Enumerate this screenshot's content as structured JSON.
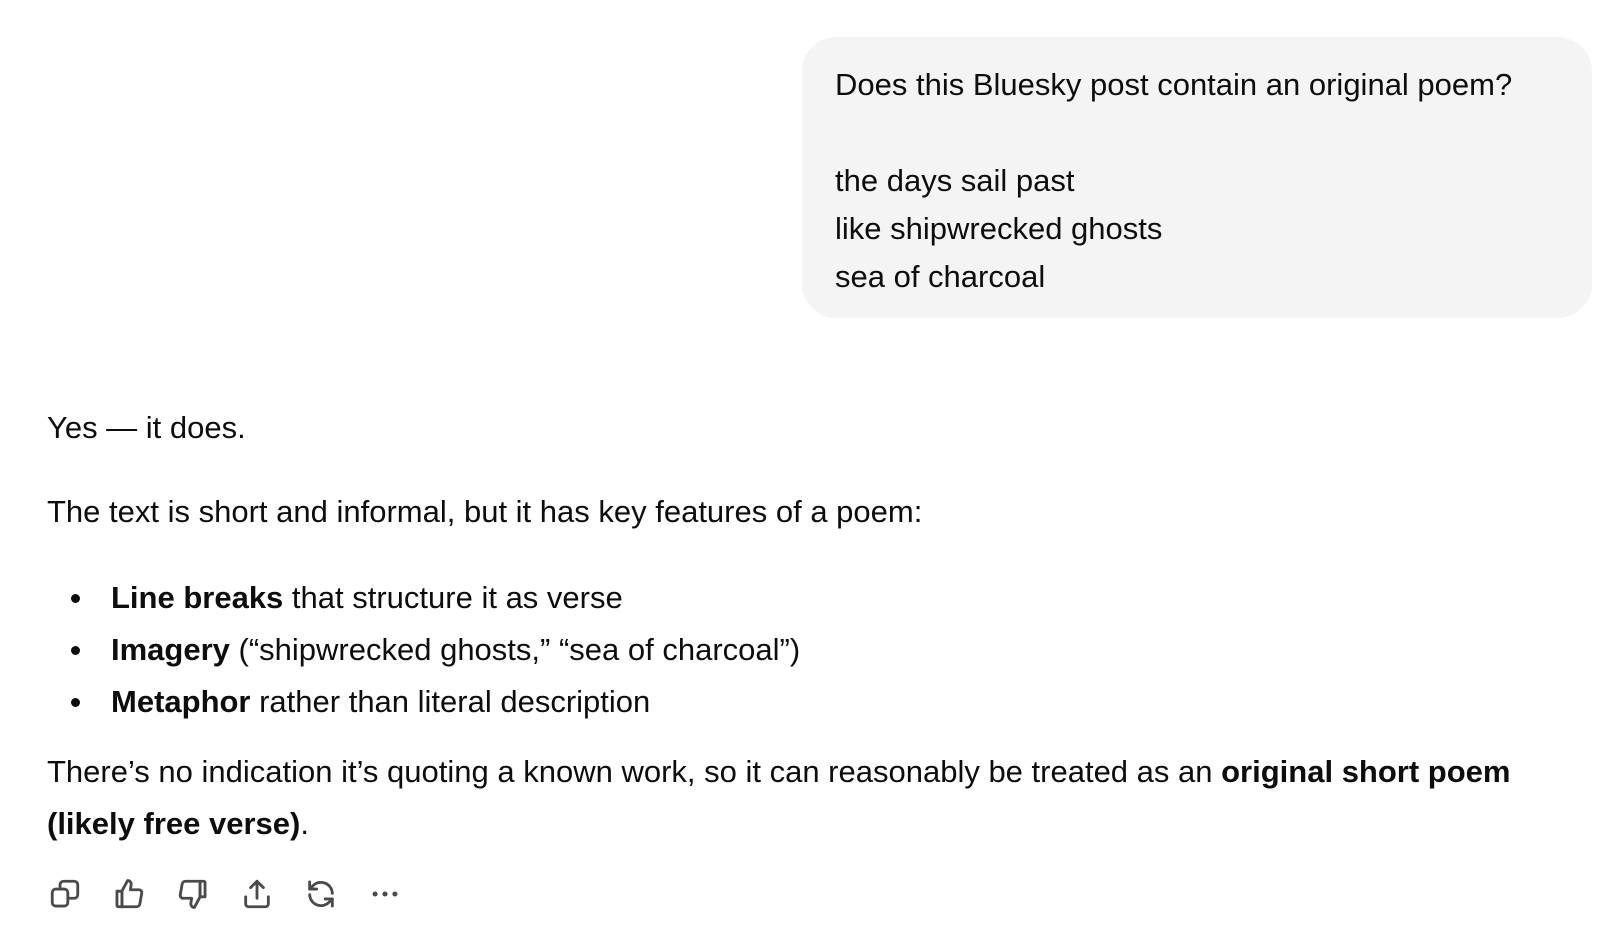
{
  "user_message": {
    "text": "Does this Bluesky post contain an original poem?\n\nthe days sail past\nlike shipwrecked ghosts\nsea of charcoal"
  },
  "assistant_message": {
    "answer": "Yes — it does.",
    "intro": "The text is short and informal, but it has key features of a poem:",
    "bullets": [
      {
        "bold": "Line breaks",
        "rest": " that structure it as verse"
      },
      {
        "bold": "Imagery",
        "rest": " (“shipwrecked ghosts,” “sea of charcoal”)"
      },
      {
        "bold": "Metaphor",
        "rest": " rather than literal description"
      }
    ],
    "conclusion": {
      "prefix": "There’s no indication it’s quoting a known work, so it can reasonably be treated as an ",
      "bold": "original short poem (likely free verse)",
      "suffix": "."
    }
  },
  "actions": [
    {
      "name": "copy-button",
      "icon": "copy-icon"
    },
    {
      "name": "thumbs-up-button",
      "icon": "thumbs-up-icon"
    },
    {
      "name": "thumbs-down-button",
      "icon": "thumbs-down-icon"
    },
    {
      "name": "share-button",
      "icon": "share-icon"
    },
    {
      "name": "regenerate-button",
      "icon": "regenerate-icon"
    },
    {
      "name": "more-options-button",
      "icon": "more-horizontal-icon"
    }
  ]
}
